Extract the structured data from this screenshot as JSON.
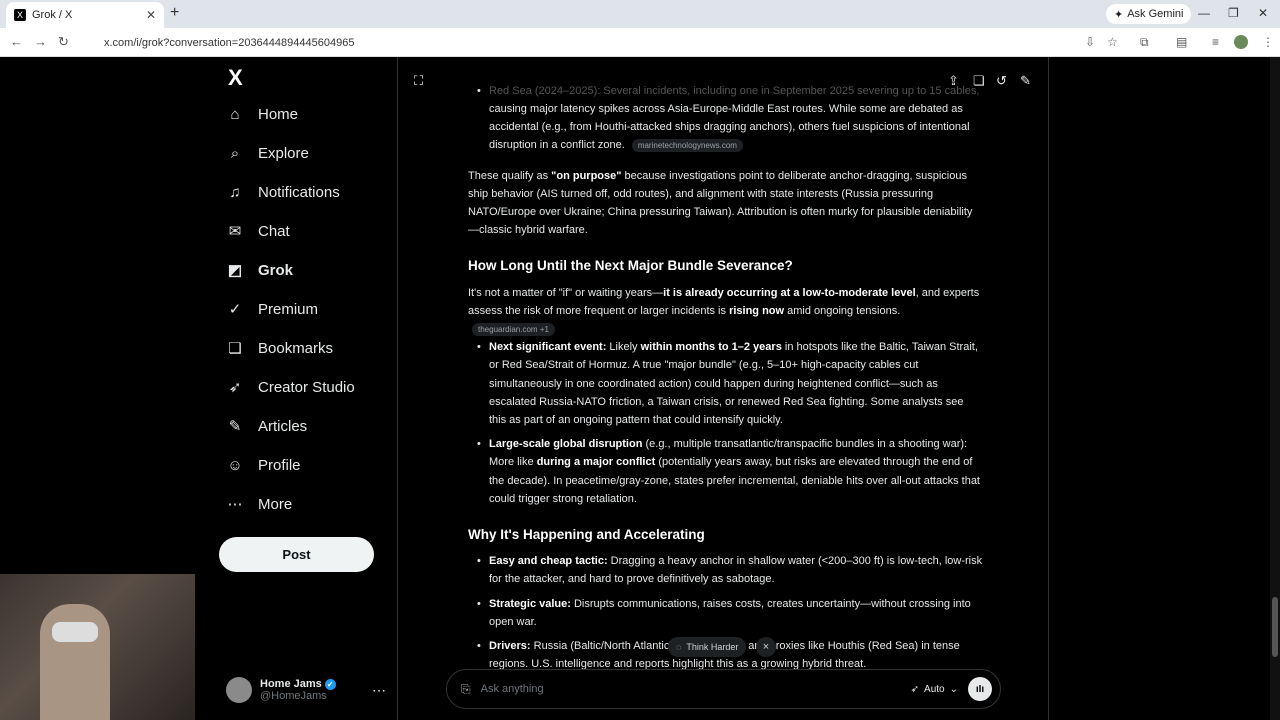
{
  "browser": {
    "tab_title": "Grok / X",
    "tab_favicon": "X",
    "new_tab": "+",
    "ask_gemini": "Ask Gemini",
    "url": "x.com/i/grok?conversation=2036444894445604965"
  },
  "sidebar": {
    "logo": "X",
    "items": [
      {
        "label": "Home",
        "icon": "home-icon",
        "glyph": "⌂"
      },
      {
        "label": "Explore",
        "icon": "search-icon",
        "glyph": "⌕"
      },
      {
        "label": "Notifications",
        "icon": "bell-icon",
        "glyph": "♫"
      },
      {
        "label": "Chat",
        "icon": "mail-icon",
        "glyph": "✉"
      },
      {
        "label": "Grok",
        "icon": "grok-icon",
        "glyph": "◩"
      },
      {
        "label": "Premium",
        "icon": "premium-icon",
        "glyph": "✓"
      },
      {
        "label": "Bookmarks",
        "icon": "bookmark-icon",
        "glyph": "❏"
      },
      {
        "label": "Creator Studio",
        "icon": "rocket-icon",
        "glyph": "➶"
      },
      {
        "label": "Articles",
        "icon": "article-icon",
        "glyph": "✎"
      },
      {
        "label": "Profile",
        "icon": "person-icon",
        "glyph": "☺"
      },
      {
        "label": "More",
        "icon": "more-circle-icon",
        "glyph": "⋯"
      }
    ],
    "post_label": "Post",
    "profile": {
      "name": "Home Jams",
      "handle": "@HomeJams"
    }
  },
  "conversation": {
    "top_partial": "Red Sea (2024–2025): Several incidents, including one in September 2025 severing up to 15 cables,",
    "partial_para": "causing major latency spikes across Asia-Europe-Middle East routes. While some are debated as accidental (e.g., from Houthi-attacked ships dragging anchors), others fuel suspicions of intentional disruption in a conflict zone.",
    "partial_src": "marinetechnologynews.com",
    "para1_a": "These qualify as ",
    "para1_b": "\"on purpose\"",
    "para1_c": " because investigations point to deliberate anchor-dragging, suspicious ship behavior (AIS turned off, odd routes), and alignment with state interests (Russia pressuring NATO/Europe over Ukraine; China pressuring Taiwan). Attribution is often murky for plausible deniability—classic hybrid warfare.",
    "h1": "How Long Until the Next Major Bundle Severance?",
    "para2_a": "It's not a matter of \"if\" or waiting years—",
    "para2_b": "it is already occurring at a low-to-moderate level",
    "para2_c": ", and experts assess the risk of more frequent or larger incidents is ",
    "para2_d": "rising now",
    "para2_e": " amid ongoing tensions.",
    "para2_src": "theguardian.com +1",
    "b1_label": "Next significant event:",
    "b1_a": " Likely ",
    "b1_b": "within months to 1–2 years",
    "b1_c": " in hotspots like the Baltic, Taiwan Strait, or Red Sea/Strait of Hormuz. A true \"major bundle\" (e.g., 5–10+ high-capacity cables cut simultaneously in one coordinated action) could happen during heightened conflict—such as escalated Russia-NATO friction, a Taiwan crisis, or renewed Red Sea fighting. Some analysts see this as part of an ongoing pattern that could intensify quickly.",
    "b2_label": "Large-scale global disruption",
    "b2_a": " (e.g., multiple transatlantic/transpacific bundles in a shooting war): More like ",
    "b2_b": "during a major conflict",
    "b2_c": " (potentially years away, but risks are elevated through the end of the decade). In peacetime/gray-zone, states prefer incremental, deniable hits over all-out attacks that could trigger strong retaliation.",
    "h2": "Why It's Happening and Accelerating",
    "b3_label": "Easy and cheap tactic:",
    "b3_text": " Dragging a heavy anchor in shallow water (<200–300 ft) is low-tech, low-risk for the attacker, and hard to prove definitively as sabotage.",
    "b4_label": "Strategic value:",
    "b4_text": " Disrupts communications, raises costs, creates uncertainty—without crossing into open war.",
    "b5_label": "Drivers:",
    "b5_text": " Russia (Baltic/North Atlantic), China (Ta... ), and proxies like Houthis (Red Sea) in tense regions. U.S. intelligence and reports highlight this as a growing hybrid threat."
  },
  "composer": {
    "think_harder": "Think Harder",
    "close": "×",
    "placeholder": "Ask anything",
    "mode": "Auto"
  }
}
